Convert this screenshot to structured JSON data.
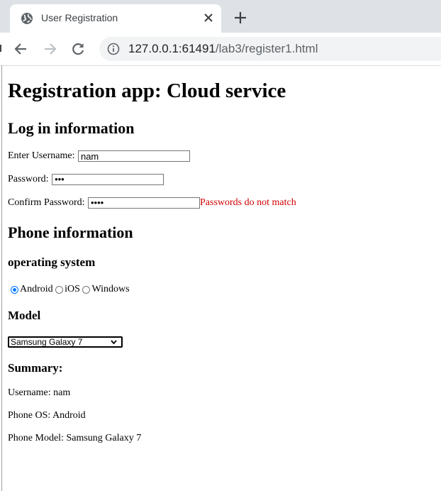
{
  "browser": {
    "tab_title": "User Registration",
    "url_host": "127.0.0.1:61491",
    "url_path": "/lab3/register1.html"
  },
  "page": {
    "title": "Registration app: Cloud service",
    "login_heading": "Log in information",
    "username_label": "Enter Username:",
    "username_value": "nam",
    "password_label": "Password:",
    "password_value": "•••",
    "confirm_label": "Confirm Password:",
    "confirm_value": "••••",
    "password_error": "Passwords do not match",
    "phone_heading": "Phone information",
    "os_heading": "operating system",
    "os_options": [
      {
        "label": "Android",
        "selected": true
      },
      {
        "label": "iOS",
        "selected": false
      },
      {
        "label": "Windows",
        "selected": false
      }
    ],
    "model_heading": "Model",
    "model_selected": "Samsung Galaxy 7",
    "summary_heading": "Summary:",
    "summary_username": "Username: nam",
    "summary_os": "Phone OS: Android",
    "summary_model": "Phone Model: Samsung Galaxy 7"
  },
  "colors": {
    "error": "#d00000",
    "radio_accent": "#0075ff",
    "tabstrip": "#dee1e6"
  }
}
